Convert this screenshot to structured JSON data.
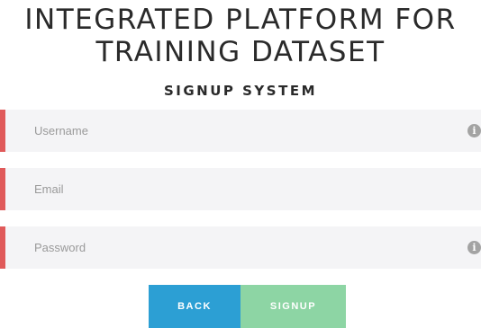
{
  "header": {
    "title_line1": "INTEGRATED PLATFORM FOR",
    "title_line2": "TRAINING DATASET",
    "subtitle": "SIGNUP SYSTEM"
  },
  "form": {
    "username": {
      "placeholder": "Username",
      "value": "",
      "info_icon": "i"
    },
    "email": {
      "placeholder": "Email",
      "value": ""
    },
    "password": {
      "placeholder": "Password",
      "value": "",
      "info_icon": "i"
    }
  },
  "buttons": {
    "back_label": "BACK",
    "signup_label": "SIGNUP"
  },
  "colors": {
    "accent_bar": "#e05a5a",
    "field_bg": "#f4f4f6",
    "back_button": "#2c9fd4",
    "signup_button": "#8dd5a4"
  }
}
